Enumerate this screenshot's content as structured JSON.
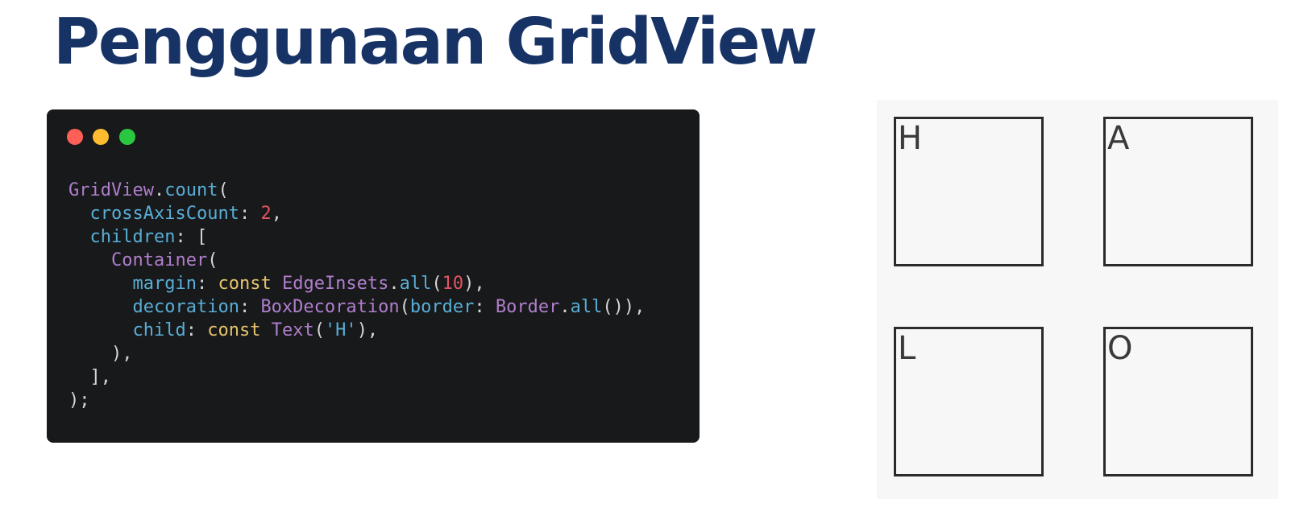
{
  "title": "Penggunaan GridView",
  "code_window": {
    "lines": [
      [
        {
          "text": "GridView",
          "kind": "class"
        },
        {
          "text": ".",
          "kind": "punc"
        },
        {
          "text": "count",
          "kind": "method"
        },
        {
          "text": "(",
          "kind": "punc"
        }
      ],
      [
        {
          "text": "  ",
          "kind": "punc"
        },
        {
          "text": "crossAxisCount",
          "kind": "prop"
        },
        {
          "text": ": ",
          "kind": "punc"
        },
        {
          "text": "2",
          "kind": "num"
        },
        {
          "text": ",",
          "kind": "punc"
        }
      ],
      [
        {
          "text": "  ",
          "kind": "punc"
        },
        {
          "text": "children",
          "kind": "prop"
        },
        {
          "text": ": [",
          "kind": "punc"
        }
      ],
      [
        {
          "text": "    ",
          "kind": "punc"
        },
        {
          "text": "Container",
          "kind": "class"
        },
        {
          "text": "(",
          "kind": "punc"
        }
      ],
      [
        {
          "text": "      ",
          "kind": "punc"
        },
        {
          "text": "margin",
          "kind": "prop"
        },
        {
          "text": ": ",
          "kind": "punc"
        },
        {
          "text": "const",
          "kind": "kw"
        },
        {
          "text": " ",
          "kind": "punc"
        },
        {
          "text": "EdgeInsets",
          "kind": "class"
        },
        {
          "text": ".",
          "kind": "punc"
        },
        {
          "text": "all",
          "kind": "method"
        },
        {
          "text": "(",
          "kind": "punc"
        },
        {
          "text": "10",
          "kind": "num"
        },
        {
          "text": "),",
          "kind": "punc"
        }
      ],
      [
        {
          "text": "      ",
          "kind": "punc"
        },
        {
          "text": "decoration",
          "kind": "prop"
        },
        {
          "text": ": ",
          "kind": "punc"
        },
        {
          "text": "BoxDecoration",
          "kind": "class"
        },
        {
          "text": "(",
          "kind": "punc"
        },
        {
          "text": "border",
          "kind": "prop"
        },
        {
          "text": ": ",
          "kind": "punc"
        },
        {
          "text": "Border",
          "kind": "class"
        },
        {
          "text": ".",
          "kind": "punc"
        },
        {
          "text": "all",
          "kind": "method"
        },
        {
          "text": "()),",
          "kind": "punc"
        }
      ],
      [
        {
          "text": "      ",
          "kind": "punc"
        },
        {
          "text": "child",
          "kind": "prop"
        },
        {
          "text": ": ",
          "kind": "punc"
        },
        {
          "text": "const",
          "kind": "kw"
        },
        {
          "text": " ",
          "kind": "punc"
        },
        {
          "text": "Text",
          "kind": "class"
        },
        {
          "text": "(",
          "kind": "punc"
        },
        {
          "text": "'H'",
          "kind": "str"
        },
        {
          "text": "),",
          "kind": "punc"
        }
      ],
      [
        {
          "text": "    ),",
          "kind": "punc"
        }
      ],
      [
        {
          "text": "  ],",
          "kind": "punc"
        }
      ],
      [
        {
          "text": ");",
          "kind": "punc"
        }
      ]
    ],
    "dots": [
      "red",
      "yellow",
      "green"
    ],
    "colors": {
      "background": "#18191b",
      "dot_red": "#fe5f57",
      "dot_yellow": "#febc2e",
      "dot_green": "#29c840"
    }
  },
  "preview": {
    "cells": [
      "H",
      "A",
      "L",
      "O"
    ]
  },
  "colors": {
    "title": "#173366",
    "preview_background": "#f7f7f7",
    "cell_border": "#2b2b2b"
  }
}
